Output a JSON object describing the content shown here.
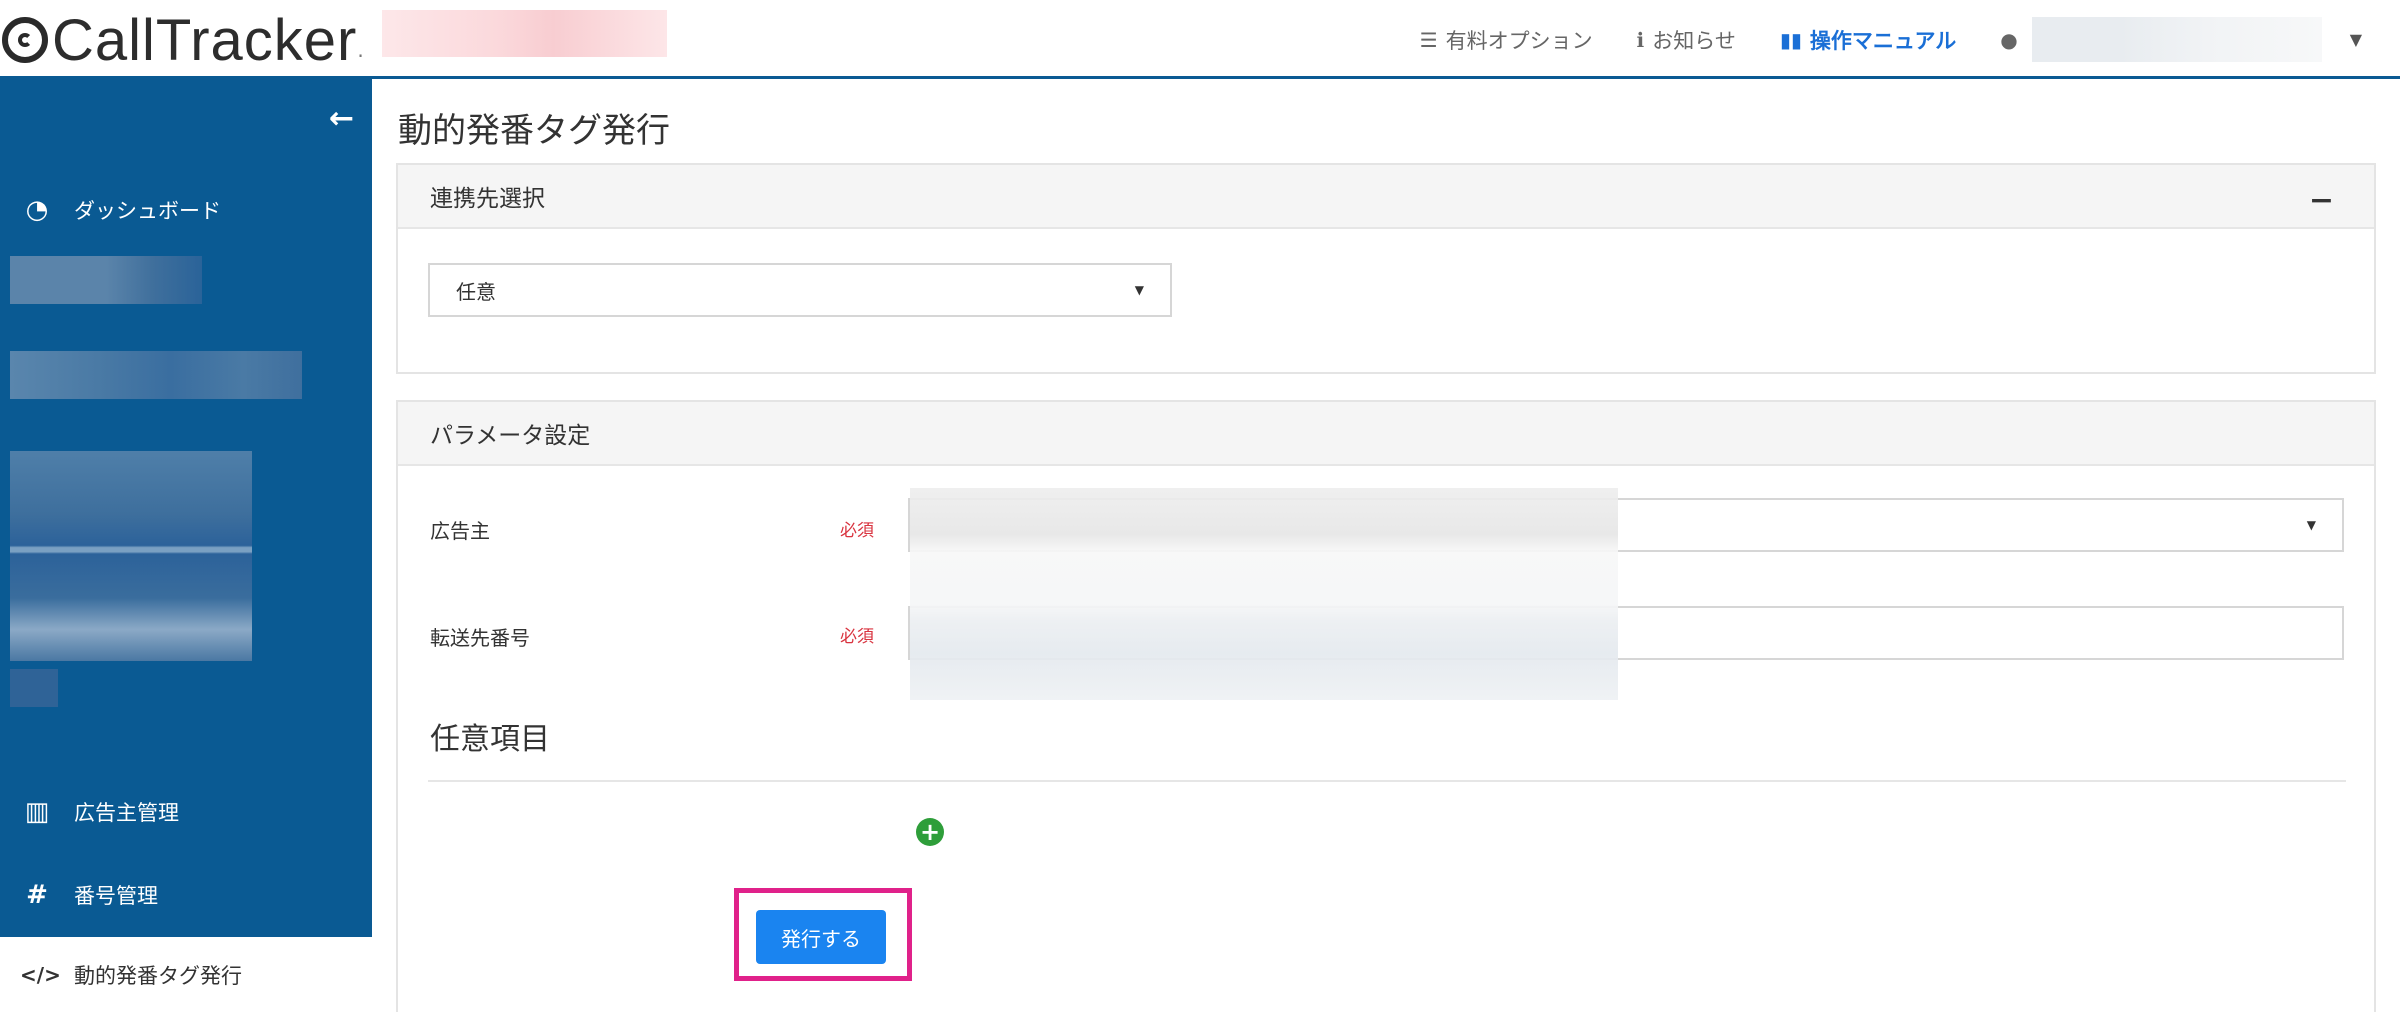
{
  "header": {
    "logo_text": "CallTracker",
    "logo_dot": ".",
    "nav": [
      {
        "label": "有料オプション",
        "icon": "list-icon"
      },
      {
        "label": "お知らせ",
        "icon": "info-icon"
      },
      {
        "label": "操作マニュアル",
        "icon": "book-icon"
      }
    ]
  },
  "sidebar": {
    "collapse_icon": "←",
    "items": [
      {
        "label": "ダッシュボード",
        "icon": "dashboard-icon",
        "glyph": "◔"
      },
      {
        "label": "広告主管理",
        "icon": "building-icon",
        "glyph": "▥"
      },
      {
        "label": "番号管理",
        "icon": "hash-icon",
        "glyph": "#"
      },
      {
        "label": "動的発番タグ発行",
        "icon": "code-icon",
        "glyph": "</>",
        "active": true
      }
    ]
  },
  "main": {
    "page_title": "動的発番タグ発行",
    "link_panel": {
      "title": "連携先選択",
      "select_value": "任意"
    },
    "param_panel": {
      "title": "パラメータ設定",
      "fields": [
        {
          "label": "広告主",
          "required_label": "必須"
        },
        {
          "label": "転送先番号",
          "required_label": "必須"
        }
      ],
      "optional_heading": "任意項目",
      "submit_label": "発行する"
    }
  },
  "colors": {
    "sidebar_bg": "#0a5a93",
    "accent": "#1a84f0",
    "highlight": "#e0218a",
    "required": "#d9333f",
    "add": "#2e9e3a"
  }
}
